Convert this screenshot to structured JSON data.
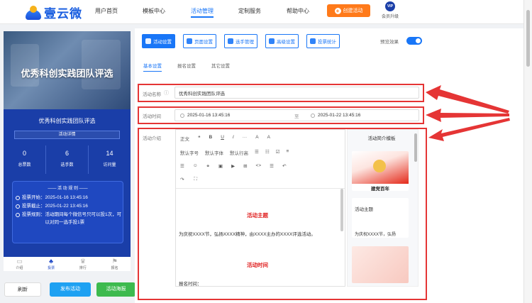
{
  "brand": {
    "name": "壹云微"
  },
  "nav": [
    {
      "label": "用户首页"
    },
    {
      "label": "模板中心"
    },
    {
      "label": "活动管理"
    },
    {
      "label": "定制服务"
    },
    {
      "label": "帮助中心"
    }
  ],
  "header": {
    "create_label": "创建活动",
    "vip_label": "会员升级",
    "vip_badge": "VIP"
  },
  "preview": {
    "banner_title": "优秀科创实践团队评选",
    "card_title": "优秀科创实践团队评选",
    "detail_label": "活动详情",
    "stats": [
      {
        "value": "0",
        "label": "总票数"
      },
      {
        "value": "6",
        "label": "选手数"
      },
      {
        "value": "14",
        "label": "访问量"
      }
    ],
    "rules_title": "—— 活 动 规 则 ——",
    "rules": [
      {
        "key": "投票开始：",
        "text": "2025-01-16 13:45:16"
      },
      {
        "key": "投票截止：",
        "text": "2025-01-22 13:45:16"
      },
      {
        "key": "投票规则：",
        "text": "活动期间每个微信号只可以投1次，可以对同一选手投1票"
      }
    ],
    "tabs": [
      {
        "label": "介绍",
        "icon": "book-icon"
      },
      {
        "label": "投票",
        "icon": "vote-icon"
      },
      {
        "label": "排行",
        "icon": "crown-icon"
      },
      {
        "label": "报名",
        "icon": "flag-icon"
      }
    ]
  },
  "actions": {
    "refresh": "刷新",
    "publish": "发布活动",
    "share": "活动海报"
  },
  "toolbar": [
    {
      "label": "活动设置"
    },
    {
      "label": "页面设置"
    },
    {
      "label": "选手管理"
    },
    {
      "label": "高级设置"
    },
    {
      "label": "投票统计"
    }
  ],
  "preview_toggle": {
    "label": "预览效果",
    "on": true
  },
  "subtabs": [
    {
      "label": "基本设置"
    },
    {
      "label": "报名设置"
    },
    {
      "label": "其它设置"
    }
  ],
  "form": {
    "name_label": "活动名称",
    "name_value": "优秀科创实践团队评选",
    "time_label": "活动时间",
    "time_start": "2025-01-16 13:45:16",
    "time_sep": "至",
    "time_end": "2025-01-22 13:45:16",
    "intro_label": "活动介绍"
  },
  "editor": {
    "row1": [
      "正文",
      "❝",
      "B",
      "U",
      "I",
      "···",
      "A",
      "A"
    ],
    "row2": [
      "默认字号",
      "默认字体",
      "默认行高",
      "☰",
      "☷",
      "☑",
      "≡"
    ],
    "row3": [
      "☰",
      "☺",
      "⚭",
      "▣",
      "▶",
      "⊞",
      "<>",
      "☰",
      "↶"
    ],
    "row4": [
      "↷",
      "⛶"
    ],
    "heading1": "活动主题",
    "para1": "为庆祝XXXX节，弘扬XXXX精神，由XXXX主办的XXXX评选活动。",
    "heading2": "活动时间",
    "para2": "报名时间："
  },
  "templates": {
    "title": "活动简介模板",
    "card1_caption": "建党百年",
    "card2_title": "活动主题",
    "card2_text": "为庆祝XXXX节，弘扬"
  },
  "colors": {
    "primary": "#1976f7",
    "highlight": "#e53535",
    "orange": "#ff7a1a"
  }
}
